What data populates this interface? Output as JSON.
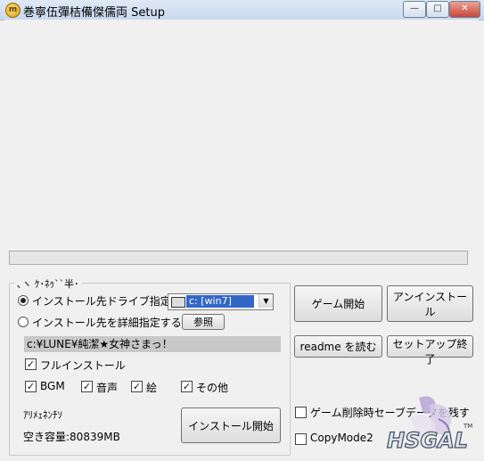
{
  "window": {
    "title": "巻寧伍彈桔備傑儒両 Setup",
    "icon": "app-icon",
    "controls": {
      "minimize": "—",
      "maximize": "□",
      "close": "✕"
    }
  },
  "progress": {
    "fraction": 0.0
  },
  "group": {
    "legend": "､ヽ ｹ･ﾈｩ``半･",
    "radio_drive_label": "インストール先ドライブ指定",
    "drive_select_value": "c: [win7]",
    "radio_detail_label": "インストール先を詳細指定する",
    "browse_button": "参照",
    "install_path": "c:¥LUNE¥純潔★女神さまっ！",
    "full_install_label": "フルインストール",
    "options": [
      {
        "label": "BGM",
        "checked": true
      },
      {
        "label": "音声",
        "checked": true
      },
      {
        "label": "絵",
        "checked": true
      },
      {
        "label": "その他",
        "checked": true
      }
    ],
    "status_label": "ｱﾘﾒｪﾈﾝﾁｿ",
    "free_space": "空き容量:80839MB",
    "install_button": "インストール開始"
  },
  "buttons": {
    "game_start": "ゲーム開始",
    "uninstall": "アンインストール",
    "readme": "readme を読む",
    "setup_exit": "セットアップ終了"
  },
  "checkboxes": {
    "keep_save_label": "ゲーム削除時セーブデータを残す",
    "copymode_label": "CopyMode2"
  },
  "brand": {
    "logo": "HSGAL",
    "tm": "TM"
  }
}
